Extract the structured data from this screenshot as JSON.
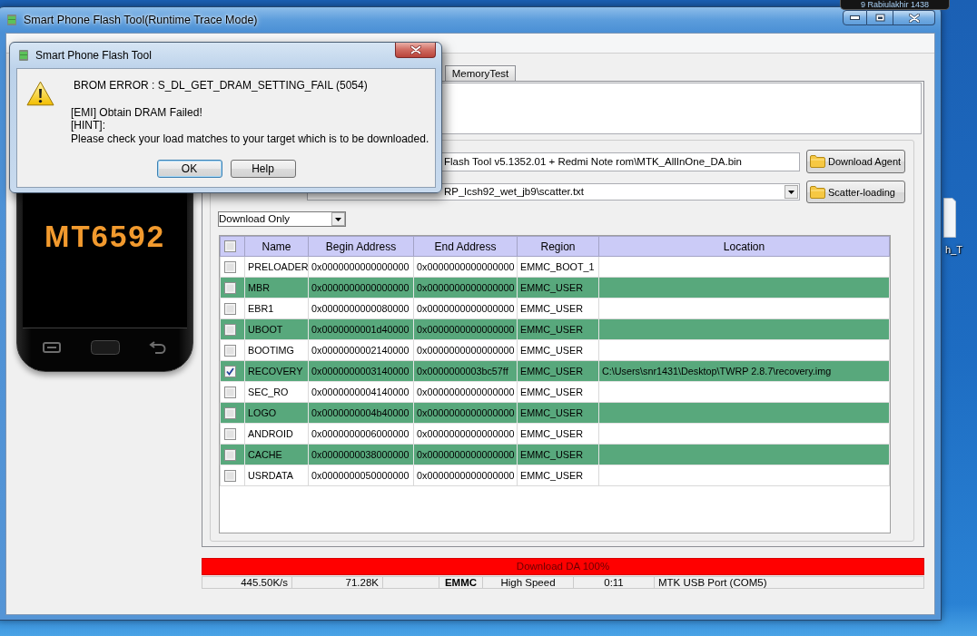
{
  "desktop": {
    "date_tooltip": "9 Rabiulakhir 1438",
    "icons": [
      {
        "label": "h_T"
      }
    ]
  },
  "window": {
    "title": "Smart Phone Flash Tool(Runtime Trace Mode)"
  },
  "tabs": [
    {
      "label": "MemoryTest",
      "selected": false
    }
  ],
  "phone": {
    "chip_label": "MT6592"
  },
  "download_agent": {
    "path": "Flash Tool v5.1352.01 + Redmi Note rom\\MTK_AllInOne_DA.bin",
    "button": "Download Agent"
  },
  "scatter_loading": {
    "path": "RP_lcsh92_wet_jb9\\scatter.txt",
    "button": "Scatter-loading"
  },
  "mode_select": {
    "value": "Download Only"
  },
  "table": {
    "header_checked": false,
    "columns": [
      "Name",
      "Begin Address",
      "End Address",
      "Region",
      "Location"
    ],
    "rows": [
      {
        "checked": false,
        "name": "PRELOADER",
        "begin_address": "0x0000000000000000",
        "end_address": "0x0000000000000000",
        "region": "EMMC_BOOT_1"
      },
      {
        "checked": false,
        "name": "MBR",
        "begin_address": "0x0000000000000000",
        "end_address": "0x0000000000000000",
        "region": "EMMC_USER"
      },
      {
        "checked": false,
        "name": "EBR1",
        "begin_address": "0x0000000000080000",
        "end_address": "0x0000000000000000",
        "region": "EMMC_USER"
      },
      {
        "checked": false,
        "name": "UBOOT",
        "begin_address": "0x0000000001d40000",
        "end_address": "0x0000000000000000",
        "region": "EMMC_USER"
      },
      {
        "checked": false,
        "name": "BOOTIMG",
        "begin_address": "0x0000000002140000",
        "end_address": "0x0000000000000000",
        "region": "EMMC_USER"
      },
      {
        "checked": true,
        "name": "RECOVERY",
        "begin_address": "0x0000000003140000",
        "end_address": "0x0000000003bc57ff",
        "region": "EMMC_USER",
        "location": "C:\\Users\\snr1431\\Desktop\\TWRP 2.8.7\\recovery.img"
      },
      {
        "checked": false,
        "name": "SEC_RO",
        "begin_address": "0x0000000004140000",
        "end_address": "0x0000000000000000",
        "region": "EMMC_USER"
      },
      {
        "checked": false,
        "name": "LOGO",
        "begin_address": "0x0000000004b40000",
        "end_address": "0x0000000000000000",
        "region": "EMMC_USER"
      },
      {
        "checked": false,
        "name": "ANDROID",
        "begin_address": "0x0000000006000000",
        "end_address": "0x0000000000000000",
        "region": "EMMC_USER"
      },
      {
        "checked": false,
        "name": "CACHE",
        "begin_address": "0x0000000038000000",
        "end_address": "0x0000000000000000",
        "region": "EMMC_USER"
      },
      {
        "checked": false,
        "name": "USRDATA",
        "begin_address": "0x0000000050000000",
        "end_address": "0x0000000000000000",
        "region": "EMMC_USER"
      }
    ]
  },
  "progress": {
    "label": "Download DA 100%",
    "level": 1
  },
  "status_bar": {
    "speed": "445.50K/s",
    "size": "71.28K",
    "storage": "EMMC",
    "usb_speed": "High Speed",
    "elapsed": "0:11",
    "port": "MTK USB Port (COM5)"
  },
  "dialog": {
    "title": "Smart Phone Flash Tool",
    "error": "BROM ERROR : S_DL_GET_DRAM_SETTING_FAIL (5054)",
    "lines": [
      "[EMI] Obtain DRAM Failed!",
      "[HINT]:",
      "Please check your load matches to your target which is to be downloaded."
    ],
    "buttons": [
      {
        "label": "OK",
        "default": true
      },
      {
        "label": "Help",
        "default": false
      }
    ]
  }
}
